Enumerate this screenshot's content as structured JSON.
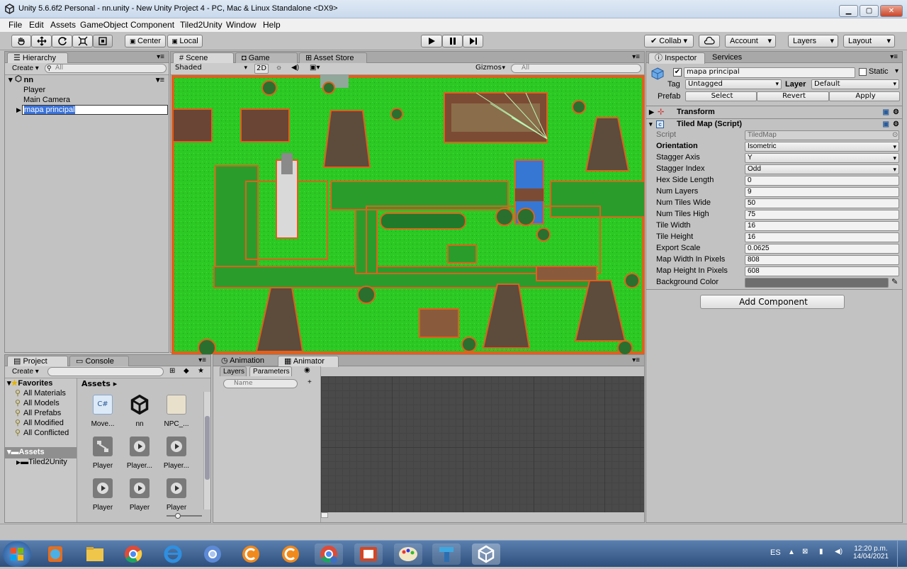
{
  "window": {
    "title": "Unity 5.6.6f2 Personal - nn.unity - New Unity Project 4 - PC, Mac & Linux Standalone <DX9>",
    "min": "▁",
    "max": "▢",
    "close": "✕"
  },
  "menu": [
    "File",
    "Edit",
    "Assets",
    "GameObject",
    "Component",
    "Tiled2Unity",
    "Window",
    "Help"
  ],
  "toolbar": {
    "pivot": "Center",
    "space": "Local",
    "collab": "Collab",
    "account": "Account",
    "layers": "Layers",
    "layout": "Layout"
  },
  "hierarchy": {
    "tab": "Hierarchy",
    "create": "Create",
    "search": "All",
    "scene": "nn",
    "items": [
      "Player",
      "Main Camera",
      "mapa principal"
    ]
  },
  "scene": {
    "tabs": [
      "Scene",
      "Game",
      "Asset Store"
    ],
    "shading": "Shaded",
    "mode2d": "2D",
    "gizmos": "Gizmos",
    "search": "All"
  },
  "inspector": {
    "tabs": [
      "Inspector",
      "Services"
    ],
    "name": "mapa principal",
    "static": "Static",
    "tag_label": "Tag",
    "tag": "Untagged",
    "layer_label": "Layer",
    "layer": "Default",
    "prefab_label": "Prefab",
    "prefab_buttons": [
      "Select",
      "Revert",
      "Apply"
    ],
    "transform": "Transform",
    "component": "Tiled Map (Script)",
    "props": [
      {
        "k": "Script",
        "v": "TiledMap",
        "dd": false
      },
      {
        "k": "Orientation",
        "v": "Isometric",
        "dd": true
      },
      {
        "k": "Stagger Axis",
        "v": "Y",
        "dd": true
      },
      {
        "k": "Stagger Index",
        "v": "Odd",
        "dd": true
      },
      {
        "k": "Hex Side Length",
        "v": "0",
        "dd": false
      },
      {
        "k": "Num Layers",
        "v": "9",
        "dd": false
      },
      {
        "k": "Num Tiles Wide",
        "v": "50",
        "dd": false
      },
      {
        "k": "Num Tiles High",
        "v": "75",
        "dd": false
      },
      {
        "k": "Tile Width",
        "v": "16",
        "dd": false
      },
      {
        "k": "Tile Height",
        "v": "16",
        "dd": false
      },
      {
        "k": "Export Scale",
        "v": "0.0625",
        "dd": false
      },
      {
        "k": "Map Width In Pixels",
        "v": "808",
        "dd": false
      },
      {
        "k": "Map Height In Pixels",
        "v": "608",
        "dd": false
      },
      {
        "k": "Background Color",
        "v": "",
        "dd": false
      }
    ],
    "add_component": "Add Component"
  },
  "project": {
    "tabs": [
      "Project",
      "Console"
    ],
    "create": "Create",
    "favorites": "Favorites",
    "fav_items": [
      "All Materials",
      "All Models",
      "All Prefabs",
      "All Modified",
      "All Conflicted"
    ],
    "assets_root": "Assets",
    "tree_items": [
      "Tiled2Unity"
    ],
    "breadcrumb": "Assets",
    "assets": [
      {
        "label": "Move...",
        "icon": "csharp-icon"
      },
      {
        "label": "nn",
        "icon": "unity-scene-icon"
      },
      {
        "label": "NPC_...",
        "icon": "sprite-sheet-icon"
      },
      {
        "label": "Player",
        "icon": "animator-controller-icon"
      },
      {
        "label": "Player...",
        "icon": "animation-clip-icon"
      },
      {
        "label": "Player...",
        "icon": "animation-clip-icon"
      },
      {
        "label": "Player",
        "icon": "animation-clip-icon"
      },
      {
        "label": "Player",
        "icon": "animation-clip-icon"
      },
      {
        "label": "Player",
        "icon": "animation-clip-icon"
      }
    ]
  },
  "animator": {
    "tabs": [
      "Animation",
      "Animator"
    ],
    "subtabs": [
      "Layers",
      "Parameters"
    ],
    "search": "Name"
  },
  "taskbar": {
    "lang": "ES",
    "time": "12:20 p.m.",
    "date": "14/04/2021"
  }
}
